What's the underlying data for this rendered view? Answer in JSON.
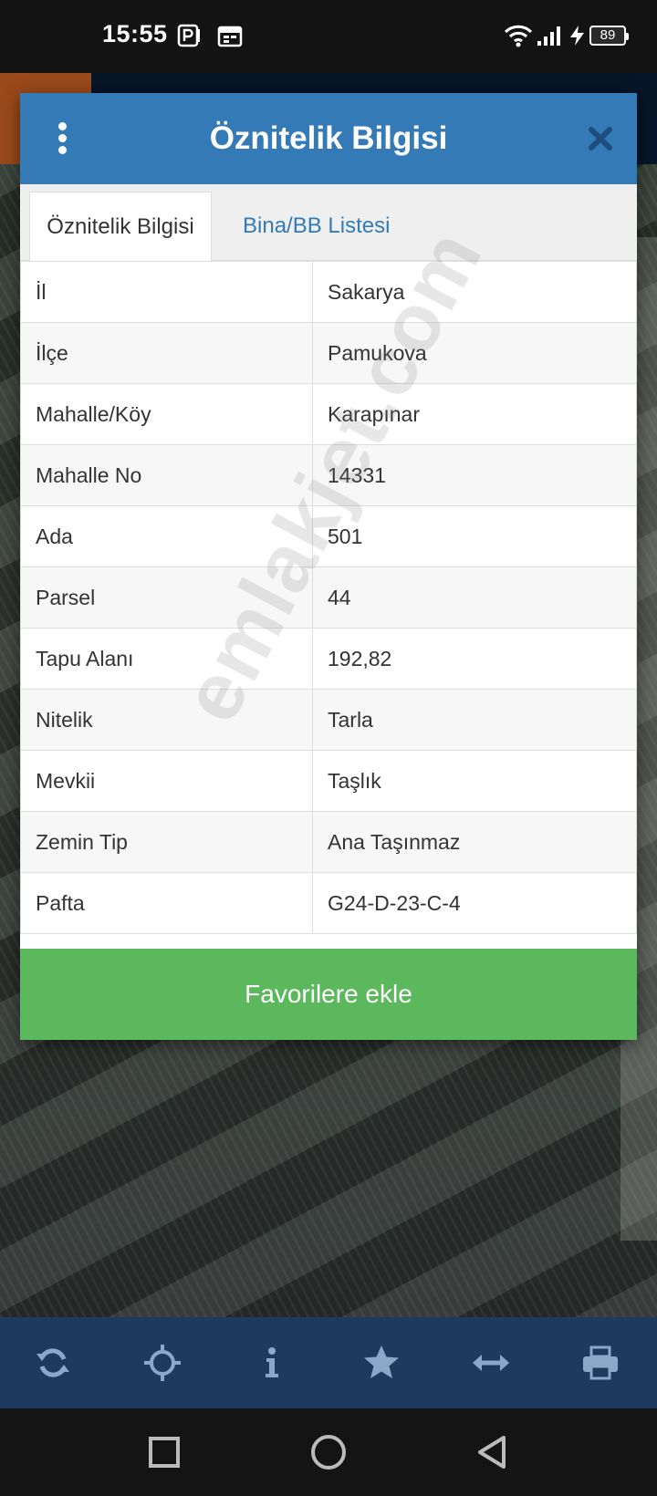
{
  "status_bar": {
    "time": "15:55",
    "battery": "89"
  },
  "dialog": {
    "title": "Öznitelik Bilgisi",
    "tabs": [
      {
        "label": "Öznitelik Bilgisi",
        "active": true
      },
      {
        "label": "Bina/BB Listesi",
        "active": false
      }
    ],
    "rows": [
      {
        "key": "İl",
        "value": "Sakarya"
      },
      {
        "key": "İlçe",
        "value": "Pamukova"
      },
      {
        "key": "Mahalle/Köy",
        "value": "Karapınar"
      },
      {
        "key": "Mahalle No",
        "value": "14331"
      },
      {
        "key": "Ada",
        "value": "501"
      },
      {
        "key": "Parsel",
        "value": "44"
      },
      {
        "key": "Tapu Alanı",
        "value": "192,82"
      },
      {
        "key": "Nitelik",
        "value": "Tarla"
      },
      {
        "key": "Mevkii",
        "value": "Taşlık"
      },
      {
        "key": "Zemin Tip",
        "value": "Ana Taşınmaz"
      },
      {
        "key": "Pafta",
        "value": "G24-D-23-C-4"
      }
    ],
    "favorite_label": "Favorilere ekle"
  },
  "watermark": "emlakjet.com",
  "toolbar": {
    "icons": [
      "refresh-icon",
      "crosshair-icon",
      "info-icon",
      "star-icon",
      "measure-icon",
      "print-icon"
    ]
  },
  "nav_bar": {
    "icons": [
      "recents-square-icon",
      "home-circle-icon",
      "back-triangle-icon"
    ]
  },
  "colors": {
    "header": "#337ab7",
    "favorite_button": "#5cb85c",
    "toolbar": "#1f3a5f",
    "tab_link": "#337ab7"
  }
}
